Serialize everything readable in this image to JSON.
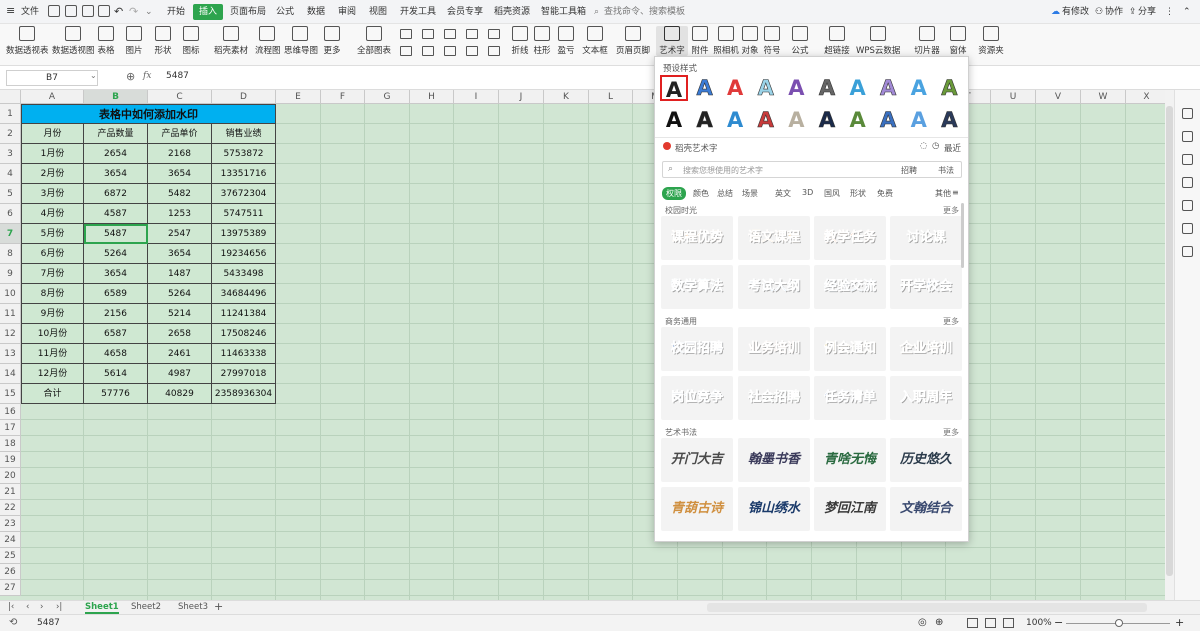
{
  "menubar": {
    "file": "文件",
    "tabs": [
      "开始",
      "插入",
      "页面布局",
      "公式",
      "数据",
      "审阅",
      "视图",
      "开发工具",
      "会员专享",
      "稻壳资源",
      "智能工具箱"
    ],
    "active_tab": "插入",
    "search_placeholder": "查找命令、搜索模板",
    "right": [
      "有修改",
      "协作",
      "分享"
    ]
  },
  "ribbon": {
    "buttons": [
      "数据透视表",
      "数据透视图",
      "表格",
      "图片",
      "形状",
      "图标",
      "稻壳素材",
      "流程图",
      "思维导图",
      "更多",
      "全部图表",
      "折线",
      "柱形",
      "盈亏",
      "文本框",
      "页眉页脚",
      "艺术字",
      "附件",
      "照相机",
      "对象",
      "符号",
      "公式",
      "超链接",
      "WPS云数据",
      "切片器",
      "窗体",
      "资源夹"
    ]
  },
  "formula": {
    "cell_ref": "B7",
    "fx": "fx",
    "value": "5487"
  },
  "columns": [
    "A",
    "B",
    "C",
    "D",
    "E",
    "F",
    "G",
    "H",
    "I",
    "J",
    "K",
    "L",
    "M",
    "N",
    "O",
    "P",
    "Q",
    "R",
    "S",
    "T",
    "U",
    "V",
    "W",
    "X"
  ],
  "rows": [
    "1",
    "2",
    "3",
    "4",
    "5",
    "6",
    "7",
    "8",
    "9",
    "10",
    "11",
    "12",
    "13",
    "14",
    "15",
    "16",
    "17",
    "18",
    "19",
    "20",
    "21",
    "22",
    "23",
    "24",
    "25",
    "26",
    "27"
  ],
  "sheet": {
    "title": "表格中如何添加水印",
    "headers": [
      "月份",
      "产品数量",
      "产品单价",
      "销售业绩"
    ],
    "data": [
      [
        "1月份",
        "2654",
        "2168",
        "5753872"
      ],
      [
        "2月份",
        "3654",
        "3654",
        "13351716"
      ],
      [
        "3月份",
        "6872",
        "5482",
        "37672304"
      ],
      [
        "4月份",
        "4587",
        "1253",
        "5747511"
      ],
      [
        "5月份",
        "5487",
        "2547",
        "13975389"
      ],
      [
        "6月份",
        "5264",
        "3654",
        "19234656"
      ],
      [
        "7月份",
        "3654",
        "1487",
        "5433498"
      ],
      [
        "8月份",
        "6589",
        "5264",
        "34684496"
      ],
      [
        "9月份",
        "2156",
        "5214",
        "11241384"
      ],
      [
        "10月份",
        "6587",
        "2658",
        "17508246"
      ],
      [
        "11月份",
        "4658",
        "2461",
        "11463338"
      ],
      [
        "12月份",
        "5614",
        "4987",
        "27997018"
      ],
      [
        "合计",
        "57776",
        "40829",
        "2358936304"
      ]
    ]
  },
  "sheet_tabs": [
    "Sheet1",
    "Sheet2",
    "Sheet3"
  ],
  "status": {
    "value": "5487",
    "zoom": "100%"
  },
  "popup": {
    "preset_title": "预设样式",
    "preset_letter": "A",
    "preset_colors_row1": [
      "#222222",
      "#3a7bd5",
      "#e03a3a",
      "#9ad3e8",
      "#7b4fb0",
      "#666666",
      "#3aa0d8",
      "#a28ad6",
      "#4aa3e0",
      "#6a9a3a"
    ],
    "preset_colors_row2": [
      "#111111",
      "#222222",
      "#2e8bd0",
      "#c83a3a",
      "#b8b0a0",
      "#1a2a4a",
      "#5a8a3a",
      "#3a70c0",
      "#5aa0e0",
      "#2a3a5a"
    ],
    "daoke_title": "稻壳艺术字",
    "recent": "最近",
    "search_placeholder": "搜索您想使用的艺术字",
    "search_btn1": "招聘",
    "search_btn2": "书法",
    "categories": [
      "权限",
      "颜色",
      "总结",
      "场景",
      "英文",
      "3D",
      "国风",
      "形状",
      "免费"
    ],
    "other": "其他",
    "more": "更多",
    "sections": [
      {
        "title": "校园时光",
        "tiles": [
          "课程优势",
          "语文课程",
          "教学任务",
          "讨论课"
        ],
        "tiles2": [
          "数学算法",
          "考试大纲",
          "经验交流",
          "开学校会"
        ]
      },
      {
        "title": "商务通用",
        "tiles": [
          "校园招聘",
          "业务培训",
          "例会通知",
          "企业培训"
        ],
        "tiles2": [
          "岗位竞争",
          "社会招聘",
          "任务清单",
          "入职周年"
        ]
      },
      {
        "title": "艺术书法",
        "tiles": [
          "开门大吉",
          "翰墨书香",
          "青啥无悔",
          "历史悠久"
        ],
        "tiles2": [
          "青葫古诗",
          "锦山绣水",
          "梦回江南",
          "文翰结合"
        ]
      }
    ],
    "tile_colors": [
      "#e8923a",
      "#f0a030",
      "#f07020",
      "#7aa060",
      "#4aa0d8",
      "#6ab0e8",
      "#3a8ad0",
      "#6a8ab0",
      "#3a6ab0",
      "#e06020",
      "#c8a030",
      "#d8a040",
      "#5a8ac0",
      "#3a7040",
      "#4a70c0",
      "#d0d0e0",
      "#4a4a4a",
      "#3a3a5a",
      "#2a6a40",
      "#2a3a4a",
      "#d09040",
      "#1a3a6a",
      "#3a3a3a",
      "#3a4a70"
    ]
  }
}
